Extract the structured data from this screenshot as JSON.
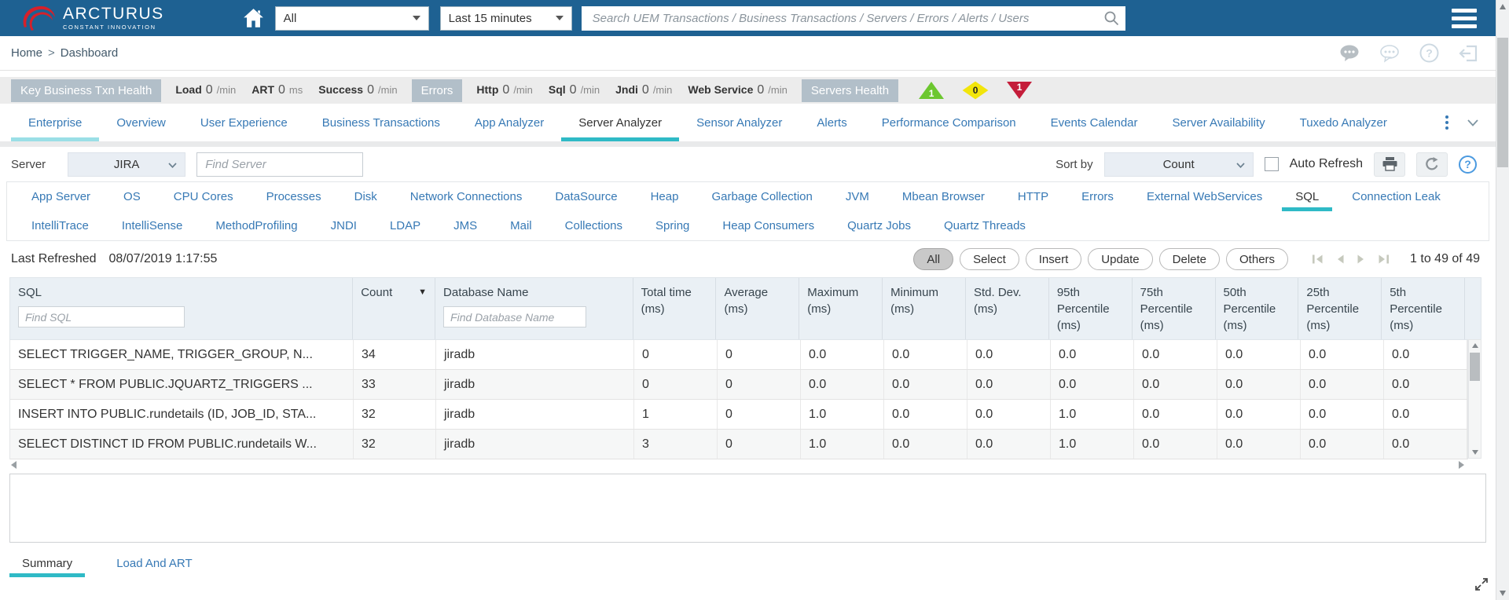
{
  "colors": {
    "navbar_bg": "#1e6192",
    "brand_red": "#d6202a",
    "accent_teal": "#2fbac6",
    "accent_teal_light": "#9adfe6",
    "link_blue": "#3779b5",
    "badge_gray": "#b2bfc9",
    "status_green": "#6cc72f",
    "status_yellow": "#f2e50b",
    "status_red": "#c41d3a"
  },
  "navbar": {
    "brand_name": "ARCTURUS",
    "brand_tagline": "CONSTANT INNOVATION",
    "scope_value": "All",
    "time_value": "Last 15 minutes",
    "search_placeholder": "Search UEM Transactions / Business Transactions / Servers / Errors / Alerts / Users"
  },
  "breadcrumb": {
    "home": "Home",
    "separator": ">",
    "current": "Dashboard"
  },
  "health": {
    "txn_badge": "Key Business Txn Health",
    "txn_metrics": [
      {
        "label": "Load",
        "value": "0",
        "unit": "/min"
      },
      {
        "label": "ART",
        "value": "0",
        "unit": "ms"
      },
      {
        "label": "Success",
        "value": "0",
        "unit": "/min"
      }
    ],
    "errors_badge": "Errors",
    "error_metrics": [
      {
        "label": "Http",
        "value": "0",
        "unit": "/min"
      },
      {
        "label": "Sql",
        "value": "0",
        "unit": "/min"
      },
      {
        "label": "Jndi",
        "value": "0",
        "unit": "/min"
      },
      {
        "label": "Web Service",
        "value": "0",
        "unit": "/min"
      }
    ],
    "servers_badge": "Servers Health",
    "indicators": [
      {
        "name": "healthy",
        "value": "1",
        "shape": "triangle-up",
        "color": "#6cc72f"
      },
      {
        "name": "warning",
        "value": "0",
        "shape": "diamond",
        "color": "#f2e50b"
      },
      {
        "name": "critical",
        "value": "1",
        "shape": "triangle-down",
        "color": "#c41d3a"
      }
    ]
  },
  "tabs": {
    "items": [
      "Enterprise",
      "Overview",
      "User Experience",
      "Business Transactions",
      "App Analyzer",
      "Server Analyzer",
      "Sensor Analyzer",
      "Alerts",
      "Performance Comparison",
      "Events Calendar",
      "Server Availability",
      "Tuxedo Analyzer"
    ],
    "selected": "Server Analyzer",
    "highlighted_first": "Enterprise"
  },
  "toolbar": {
    "server_label": "Server",
    "server_value": "JIRA",
    "find_server_placeholder": "Find Server",
    "sort_by_label": "Sort by",
    "sort_value": "Count",
    "auto_refresh_label": "Auto Refresh",
    "auto_refresh_checked": false
  },
  "subtabs": {
    "row1": [
      "App Server",
      "OS",
      "CPU Cores",
      "Processes",
      "Disk",
      "Network Connections",
      "DataSource",
      "Heap",
      "Garbage Collection",
      "JVM",
      "Mbean Browser",
      "HTTP",
      "Errors",
      "External WebServices",
      "SQL",
      "Connection Leak"
    ],
    "row2": [
      "IntelliTrace",
      "IntelliSense",
      "MethodProfiling",
      "JNDI",
      "LDAP",
      "JMS",
      "Mail",
      "Collections",
      "Spring",
      "Heap Consumers",
      "Quartz Jobs",
      "Quartz Threads"
    ],
    "selected": "SQL"
  },
  "refresh_bar": {
    "label": "Last Refreshed",
    "timestamp": "08/07/2019 1:17:55",
    "filters": [
      "All",
      "Select",
      "Insert",
      "Update",
      "Delete",
      "Others"
    ],
    "active_filter": "All",
    "range_text": "1 to 49 of 49"
  },
  "table": {
    "columns": [
      {
        "label": "SQL",
        "placeholder": "Find SQL"
      },
      {
        "label": "Count",
        "sorted": "desc"
      },
      {
        "label": "Database Name",
        "placeholder": "Find Database Name"
      },
      {
        "label": "Total time (ms)"
      },
      {
        "label": "Average (ms)"
      },
      {
        "label": "Maximum (ms)"
      },
      {
        "label": "Minimum (ms)"
      },
      {
        "label": "Std. Dev. (ms)"
      },
      {
        "label": "95th Percentile (ms)"
      },
      {
        "label": "75th Percentile (ms)"
      },
      {
        "label": "50th Percentile (ms)"
      },
      {
        "label": "25th Percentile (ms)"
      },
      {
        "label": "5th Percentile (ms)"
      }
    ],
    "rows": [
      {
        "sql": "SELECT TRIGGER_NAME, TRIGGER_GROUP, N...",
        "count": "34",
        "database": "jiradb",
        "values": [
          "0",
          "0",
          "0.0",
          "0.0",
          "0.0",
          "0.0",
          "0.0",
          "0.0",
          "0.0",
          "0.0"
        ]
      },
      {
        "sql": "SELECT * FROM PUBLIC.JQUARTZ_TRIGGERS ...",
        "count": "33",
        "database": "jiradb",
        "values": [
          "0",
          "0",
          "0.0",
          "0.0",
          "0.0",
          "0.0",
          "0.0",
          "0.0",
          "0.0",
          "0.0"
        ]
      },
      {
        "sql": "INSERT INTO PUBLIC.rundetails (ID, JOB_ID, STA...",
        "count": "32",
        "database": "jiradb",
        "values": [
          "1",
          "0",
          "1.0",
          "0.0",
          "0.0",
          "1.0",
          "0.0",
          "0.0",
          "0.0",
          "0.0"
        ]
      },
      {
        "sql": "SELECT DISTINCT ID FROM PUBLIC.rundetails W...",
        "count": "32",
        "database": "jiradb",
        "values": [
          "3",
          "0",
          "1.0",
          "0.0",
          "0.0",
          "1.0",
          "0.0",
          "0.0",
          "0.0",
          "0.0"
        ]
      }
    ]
  },
  "bottom_tabs": {
    "items": [
      "Summary",
      "Load And ART"
    ],
    "selected": "Summary"
  }
}
